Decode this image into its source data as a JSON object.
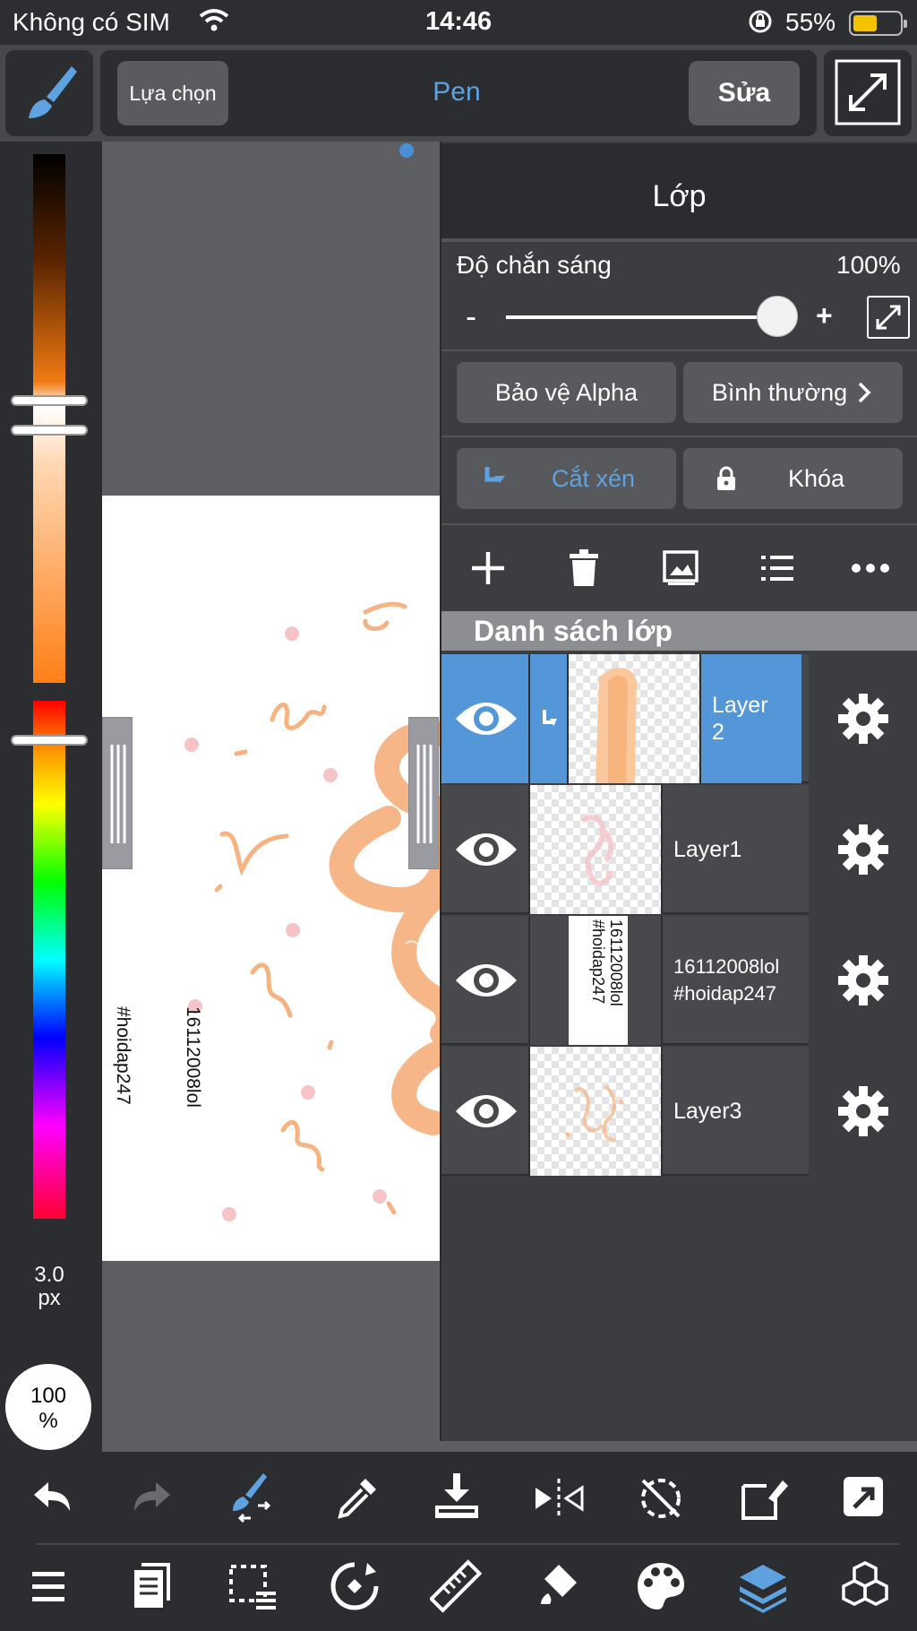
{
  "status": {
    "carrier": "Không có SIM",
    "time": "14:46",
    "battery": "55%"
  },
  "toolbar": {
    "select_label": "Lựa chọn",
    "tool_name": "Pen",
    "edit_label": "Sửa"
  },
  "brush": {
    "size_value": "3.0",
    "size_unit": "px",
    "opacity_value": "100",
    "opacity_unit": "%"
  },
  "canvas": {
    "caption_line1": "16112008lol",
    "caption_line2": "#hoidap247"
  },
  "layers_panel": {
    "title": "Lớp",
    "opacity_label": "Độ chắn sáng",
    "opacity_value": "100%",
    "opacity_fraction": 1.0,
    "minus": "-",
    "plus": "+",
    "alpha_button": "Bảo vệ Alpha",
    "blend_button": "Bình thường",
    "clip_button": "Cắt xén",
    "lock_button": "Khóa",
    "list_title": "Danh sách lớp",
    "layers": [
      {
        "name": "Layer\n2",
        "selected": true
      },
      {
        "name": "Layer1",
        "selected": false
      },
      {
        "name": "16112008lol\n#hoidap247",
        "selected": false
      },
      {
        "name": "Layer3",
        "selected": false
      }
    ]
  },
  "colors": {
    "accent": "#5ea3df",
    "selected_row": "#5397d8",
    "stroke": "#f6b381"
  },
  "icons": [
    "brush-icon",
    "expand-icon",
    "add-icon",
    "trash-icon",
    "image-icon",
    "list-icon",
    "more-icon",
    "eye-icon",
    "gear-icon",
    "undo-icon",
    "redo-icon",
    "brush-swap-icon",
    "eyedropper-icon",
    "save-icon",
    "flip-icon",
    "rotate-off-icon",
    "transform-icon",
    "share-icon",
    "menu-icon",
    "pages-icon",
    "selection-icon",
    "rotate-icon",
    "ruler-icon",
    "fill-icon",
    "palette-icon",
    "layers-icon",
    "materials-icon"
  ]
}
